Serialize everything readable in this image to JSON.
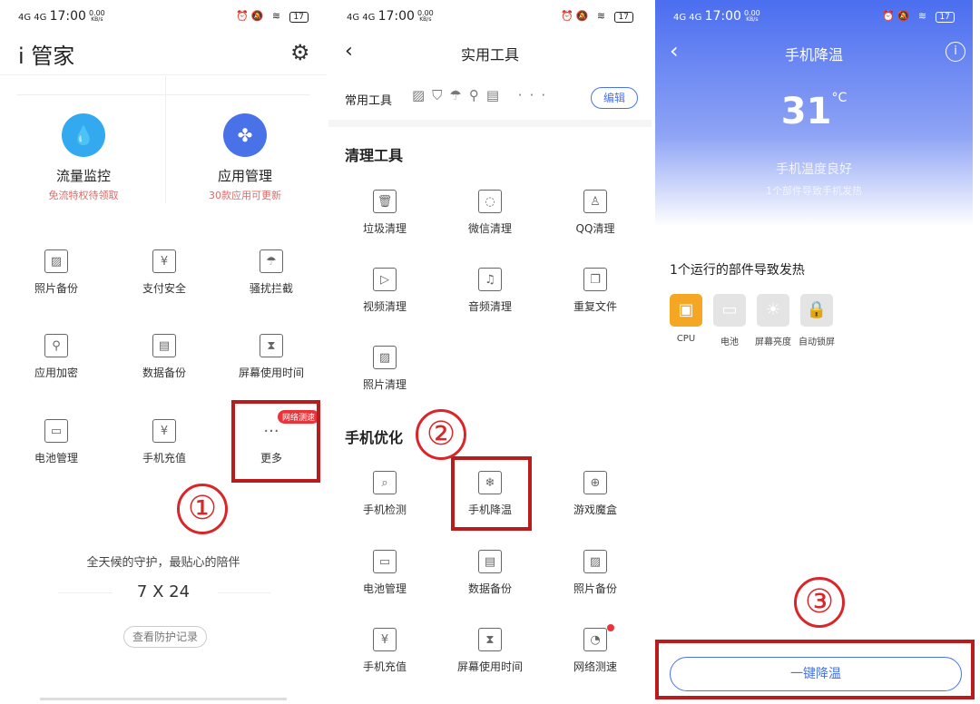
{
  "status": {
    "time": "17:00",
    "speed": "0.00",
    "battery": "17"
  },
  "screen1": {
    "title": "i 管家",
    "cards": [
      {
        "label": "流量监控",
        "sub": "免流特权待领取",
        "icon": "water-drop-icon",
        "color": "#33aaf0"
      },
      {
        "label": "应用管理",
        "sub": "30款应用可更新",
        "icon": "apps-grid-icon",
        "color": "#4a72e8"
      }
    ],
    "grid": [
      {
        "label": "照片备份",
        "icon": "image-icon"
      },
      {
        "label": "支付安全",
        "icon": "shield-yen-icon"
      },
      {
        "label": "骚扰拦截",
        "icon": "umbrella-icon"
      },
      {
        "label": "应用加密",
        "icon": "key-icon"
      },
      {
        "label": "数据备份",
        "icon": "server-icon"
      },
      {
        "label": "屏幕使用时间",
        "icon": "hourglass-icon"
      },
      {
        "label": "电池管理",
        "icon": "battery-icon"
      },
      {
        "label": "手机充值",
        "icon": "phone-yen-icon"
      },
      {
        "label": "更多",
        "icon": "more-icon"
      }
    ],
    "more_badge": "网络测速",
    "slogan": "全天候的守护，最贴心的陪伴",
    "hours": "7 X 24",
    "record_button": "查看防护记录",
    "step": "①"
  },
  "screen2": {
    "title": "实用工具",
    "common_label": "常用工具",
    "edit_button": "编辑",
    "clean_title": "清理工具",
    "clean": [
      {
        "label": "垃圾清理",
        "icon": "trash-icon"
      },
      {
        "label": "微信清理",
        "icon": "wechat-icon"
      },
      {
        "label": "QQ清理",
        "icon": "qq-icon"
      },
      {
        "label": "视频清理",
        "icon": "video-icon"
      },
      {
        "label": "音频清理",
        "icon": "music-icon"
      },
      {
        "label": "重复文件",
        "icon": "files-icon"
      },
      {
        "label": "照片清理",
        "icon": "image-icon"
      }
    ],
    "opt_title": "手机优化",
    "opt": [
      {
        "label": "手机检测",
        "icon": "search-pulse-icon"
      },
      {
        "label": "手机降温",
        "icon": "snowflake-icon"
      },
      {
        "label": "游戏魔盒",
        "icon": "gamepad-icon"
      },
      {
        "label": "电池管理",
        "icon": "battery-icon"
      },
      {
        "label": "数据备份",
        "icon": "server-icon"
      },
      {
        "label": "照片备份",
        "icon": "image-icon"
      },
      {
        "label": "手机充值",
        "icon": "phone-yen-icon"
      },
      {
        "label": "屏幕使用时间",
        "icon": "hourglass-icon"
      },
      {
        "label": "网络测速",
        "icon": "speedometer-icon"
      }
    ],
    "step": "②"
  },
  "screen3": {
    "title": "手机降温",
    "temp": "31",
    "unit": "°C",
    "status_text": "手机温度良好",
    "status_sub": "1个部件导致手机发热",
    "heading": "1个运行的部件导致发热",
    "components": [
      {
        "label": "CPU",
        "icon": "cpu-icon",
        "active": true
      },
      {
        "label": "电池",
        "icon": "battery-icon",
        "active": false
      },
      {
        "label": "屏幕亮度",
        "icon": "brightness-icon",
        "active": false
      },
      {
        "label": "自动锁屏",
        "icon": "lock-icon",
        "active": false
      }
    ],
    "cool_button": "一键降温",
    "step": "③",
    "colors": {
      "gradient_top": "#4b6ef0",
      "accent": "#f5a623",
      "annotation": "#b81c1c"
    }
  }
}
